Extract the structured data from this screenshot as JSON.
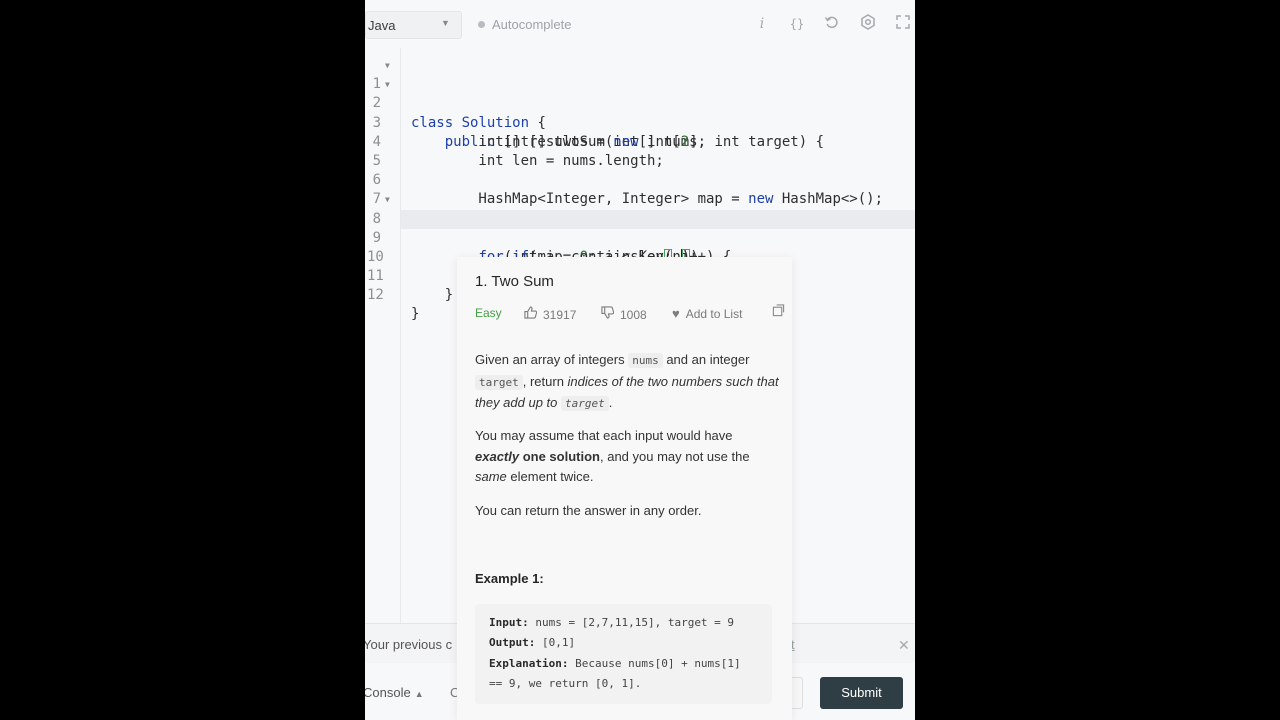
{
  "toolbar": {
    "language": "Java",
    "autocomplete_label": "Autocomplete",
    "icons": [
      "info-icon",
      "braces-icon",
      "reset-icon",
      "settings-icon",
      "fullscreen-icon"
    ]
  },
  "editor": {
    "line_numbers": [
      "1",
      "2",
      "3",
      "4",
      "5",
      "6",
      "7",
      "8",
      "9",
      "10",
      "11",
      "12"
    ],
    "lines": [
      "class Solution {",
      "    public int[] twoSum(int[] nums, int target) {",
      "        int[] results = new int[2];",
      "        int len = nums.length;",
      "",
      "        HashMap<Integer, Integer> map = new HashMap<>();",
      "",
      "        for(int i = 0; i < len; i++) {",
      "            if(map.containsKey(n))",
      "        }",
      "    }",
      "}"
    ]
  },
  "problem": {
    "title": "1. Two Sum",
    "difficulty": "Easy",
    "likes": "31917",
    "dislikes": "1008",
    "add_to_list": "Add to List",
    "para1": {
      "t1": "Given an array of integers ",
      "c1": "nums",
      "t2": " and an integer ",
      "c2": "target",
      "t3": ", return ",
      "em1": "indices of the two numbers such that they add up to",
      "t4": " ",
      "c3": "target",
      "t5": "."
    },
    "para2": {
      "t1": "You may assume that each input would have ",
      "em_bold": "exactly",
      "bold": " one solution",
      "t2": ", and you may not use the ",
      "em": "same",
      "t3": " element twice."
    },
    "para3": "You can return the answer in any order.",
    "example_title": "Example 1:",
    "example": {
      "input_label": "Input:",
      "input_value": " nums = [2,7,11,15], target = 9",
      "output_label": "Output:",
      "output_value": " [0,1]",
      "explanation_label": "Explanation:",
      "explanation_value": " Because nums[0] + nums[1]",
      "explanation_value2": "== 9, we return [0, 1]."
    }
  },
  "notice": {
    "text": "Your previous c",
    "link": "t"
  },
  "bottom": {
    "console_label": "Console",
    "run_stub": "C",
    "submit_label": "Submit"
  }
}
